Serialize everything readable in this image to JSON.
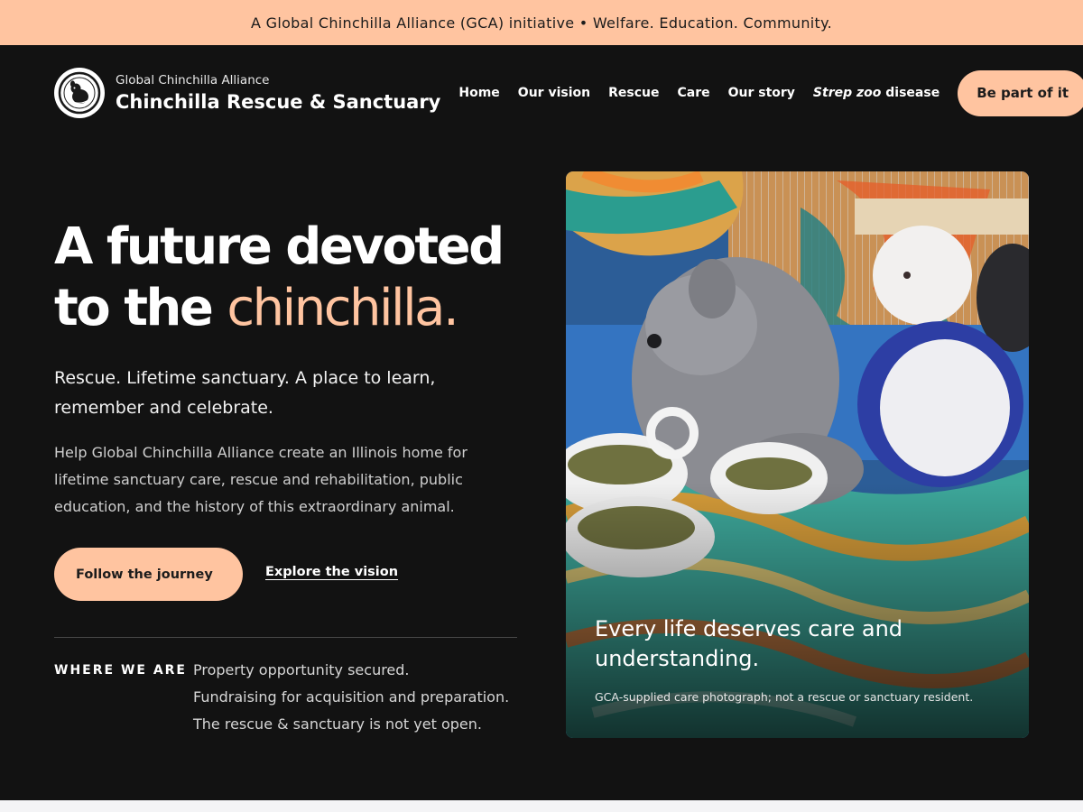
{
  "announcement": "A Global Chinchilla Alliance (GCA) initiative • Welfare. Education. Community.",
  "brand": {
    "org": "Global Chinchilla Alliance",
    "title": "Chinchilla Rescue & Sanctuary",
    "logo_icon": "chinchilla-emblem-icon"
  },
  "nav": {
    "items": [
      {
        "label": "Home"
      },
      {
        "label": "Our vision"
      },
      {
        "label": "Rescue"
      },
      {
        "label": "Care"
      },
      {
        "label": "Our story"
      }
    ],
    "disease_italic": "Strep zoo",
    "disease_rest": " disease",
    "cta": "Be part of it"
  },
  "hero": {
    "title_line1": "A future devoted",
    "title_line2_prefix": "to the ",
    "title_accent": "chinchilla.",
    "lead": "Rescue. Lifetime sanctuary. A place to learn, remember and celebrate.",
    "body": "Help Global Chinchilla Alliance create an Illinois home for lifetime sanctuary care, rescue and rehabilitation, public education, and the history of this extraordinary animal.",
    "primary_button": "Follow the journey",
    "secondary_link": "Explore the vision"
  },
  "status": {
    "label": "WHERE WE ARE",
    "items": [
      "Property opportunity secured.",
      "Fundraising for acquisition and preparation.",
      "The rescue & sanctuary is not yet open."
    ]
  },
  "photo": {
    "caption": "Every life deserves care and understanding.",
    "credit": "GCA-supplied care photograph; not a rescue or sanctuary resident."
  },
  "colors": {
    "accent": "#ffc4a0",
    "background": "#121212",
    "text": "#ffffff"
  }
}
